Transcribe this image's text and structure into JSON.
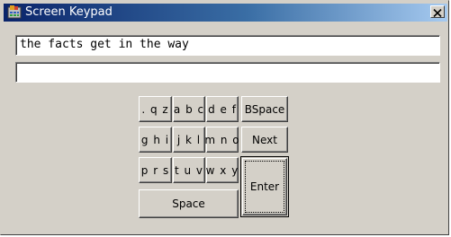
{
  "window": {
    "title": "Screen Keypad",
    "close_label": "×"
  },
  "fields": {
    "input_value": "the facts get in the way",
    "secondary_value": ""
  },
  "keys": {
    "k_qz": ". q z",
    "k_abc": "a b c",
    "k_def": "d e f",
    "k_bspace": "BSpace",
    "k_ghi": "g h i",
    "k_jkl": "j k l",
    "k_mno": "m n o",
    "k_next": "Next",
    "k_prs": "p r s",
    "k_tuv": "t u v",
    "k_wxy": "w x y",
    "k_enter": "Enter",
    "k_space": "Space"
  }
}
